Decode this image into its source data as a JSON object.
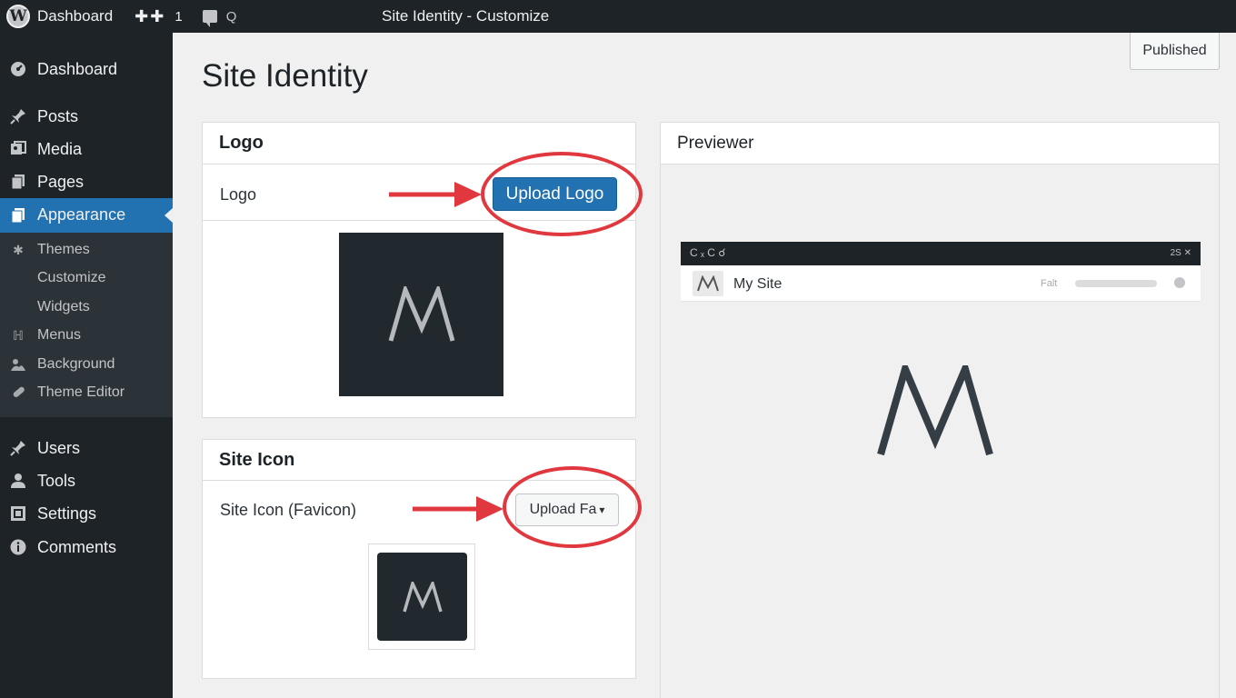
{
  "adminbar": {
    "logo_glyph": "W",
    "dashboard": "Dashboard",
    "new_glyph": "✚✚",
    "updates_count": "1",
    "search_glyph": "Q",
    "title": "Site Identity - Customize"
  },
  "sidebar": {
    "items": [
      {
        "label": "Dashboard",
        "icon": "dashboard-icon"
      },
      {
        "label": "Posts",
        "icon": "pin-icon"
      },
      {
        "label": "Media",
        "icon": "media-icon"
      },
      {
        "label": "Pages",
        "icon": "pages-icon"
      },
      {
        "label": "Appearance",
        "icon": "brush-icon"
      },
      {
        "label": "Users",
        "icon": "pin-icon"
      },
      {
        "label": "Tools",
        "icon": "user-icon"
      },
      {
        "label": "Settings",
        "icon": "settings-icon"
      },
      {
        "label": "Comments",
        "icon": "info-icon"
      }
    ],
    "submenu": [
      {
        "label": "Themes",
        "icon": "gear-icon"
      },
      {
        "label": "Customize",
        "icon": ""
      },
      {
        "label": "Widgets",
        "icon": ""
      },
      {
        "label": "Menus",
        "icon": "menus-icon"
      },
      {
        "label": "Background",
        "icon": "background-icon"
      },
      {
        "label": "Theme Editor",
        "icon": "wrench-icon"
      }
    ]
  },
  "main": {
    "title": "Site Identity",
    "status": "Published"
  },
  "logo_panel": {
    "heading": "Logo",
    "row_label": "Logo",
    "button": "Upload Logo",
    "logo_letter": "M"
  },
  "icon_panel": {
    "heading": "Site Icon",
    "row_label": "Site Icon (Favicon)",
    "button": "Upload Fa",
    "button_caret": "▾",
    "logo_letter": "M"
  },
  "previewer": {
    "heading": "Previewer",
    "bar_left": "C ₓ C ☌",
    "bar_right": "2S ✕",
    "site_name": "My Site",
    "faint_text": "Falt",
    "logo_letter": "M"
  },
  "colors": {
    "accent": "#2271b1",
    "sidebar": "#1d2327",
    "annotation": "#e0383e",
    "logo_bg": "#21282e"
  }
}
